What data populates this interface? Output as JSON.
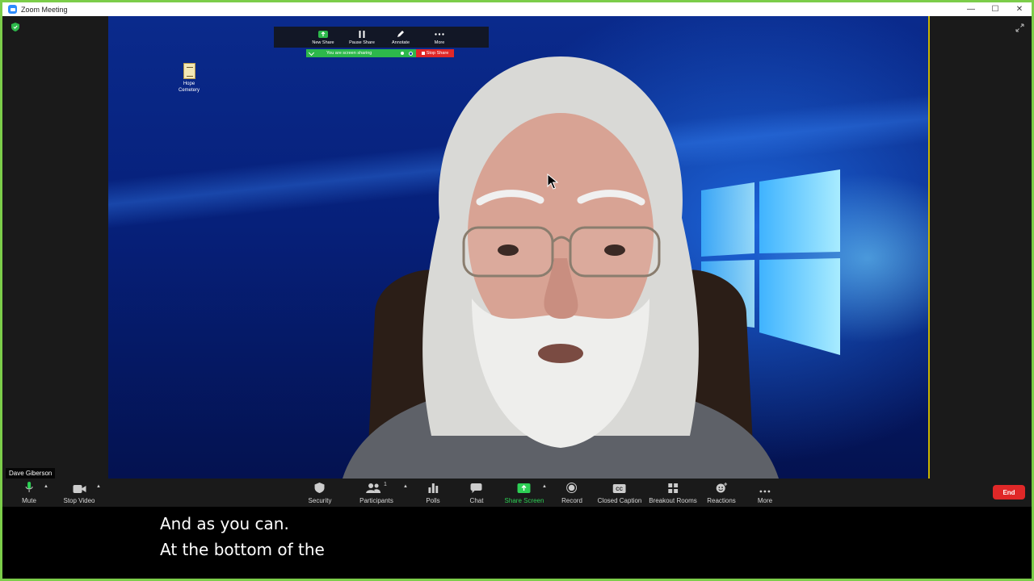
{
  "window": {
    "title": "Zoom Meeting",
    "controls": {
      "minimize": "—",
      "maximize": "☐",
      "close": "✕"
    }
  },
  "share_toolbar": {
    "buttons": [
      {
        "label": "New Share",
        "icon": "new-share-icon"
      },
      {
        "label": "Pause Share",
        "icon": "pause-icon"
      },
      {
        "label": "Annotate",
        "icon": "pencil-icon"
      },
      {
        "label": "More",
        "icon": "ellipsis-icon"
      }
    ],
    "status": "You are screen sharing",
    "stop_label": "Stop Share"
  },
  "desktop_icon": {
    "label_line1": "Hope",
    "label_line2": "Cemetery"
  },
  "participant_name": "Dave Giberson",
  "toolbar": {
    "mute": "Mute",
    "stop_video": "Stop Video",
    "security": "Security",
    "participants": "Participants",
    "participants_count": "1",
    "polls": "Polls",
    "chat": "Chat",
    "share_screen": "Share Screen",
    "record": "Record",
    "closed_caption": "Closed Caption",
    "breakout_rooms": "Breakout Rooms",
    "reactions": "Reactions",
    "more": "More",
    "end": "End"
  },
  "captions": {
    "line1": "And as you can.",
    "line2": "At the bottom of the"
  },
  "colors": {
    "share_green": "#7ccd4a",
    "status_green": "#2db84b",
    "stop_red": "#e02828",
    "toolbar_bg": "#1a1a1a",
    "active_speaker_border": "#c9b400"
  }
}
